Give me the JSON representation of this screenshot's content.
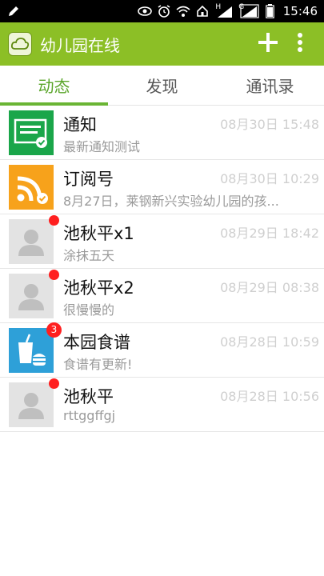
{
  "status_bar": {
    "time": "15:46",
    "h_label": "H",
    "g_label": "G",
    "icons": [
      "pencil-icon",
      "eye-icon",
      "alarm-icon",
      "wifi-icon",
      "home-icon",
      "signal-icon",
      "battery-icon"
    ]
  },
  "app_bar": {
    "title": "幼儿园在线",
    "logo_icon": "cloud-icon",
    "add_icon": "plus-icon",
    "menu_icon": "more-vertical-icon"
  },
  "tabs": [
    {
      "label": "动态",
      "active": true
    },
    {
      "label": "发现",
      "active": false
    },
    {
      "label": "通讯录",
      "active": false
    }
  ],
  "colors": {
    "brand_green": "#8cbf26",
    "active_tab": "#5aa52a",
    "notice_green": "#1aa64a",
    "rss_orange": "#f7a21b",
    "food_blue": "#2ea0d8",
    "unread_red": "#ff1f1f"
  },
  "messages": [
    {
      "title": "通知",
      "time": "08月30日 15:48",
      "preview": "最新通知测试",
      "avatar": "notice-icon",
      "unread_dot": false,
      "badge": ""
    },
    {
      "title": "订阅号",
      "time": "08月30日 10:29",
      "preview": "8月27日，莱钢新兴实验幼儿园的孩...",
      "avatar": "rss-icon",
      "unread_dot": false,
      "badge": ""
    },
    {
      "title": "池秋平x1",
      "time": "08月29日 18:42",
      "preview": "涂抹五天",
      "avatar": "person-icon",
      "unread_dot": true,
      "badge": ""
    },
    {
      "title": "池秋平x2",
      "time": "08月29日 08:38",
      "preview": "很慢慢的",
      "avatar": "person-icon",
      "unread_dot": true,
      "badge": ""
    },
    {
      "title": "本园食谱",
      "time": "08月28日 10:59",
      "preview": "食谱有更新!",
      "avatar": "food-icon",
      "unread_dot": false,
      "badge": "3"
    },
    {
      "title": "池秋平",
      "time": "08月28日 10:56",
      "preview": "rttggffgj",
      "avatar": "person-icon",
      "unread_dot": true,
      "badge": ""
    }
  ]
}
